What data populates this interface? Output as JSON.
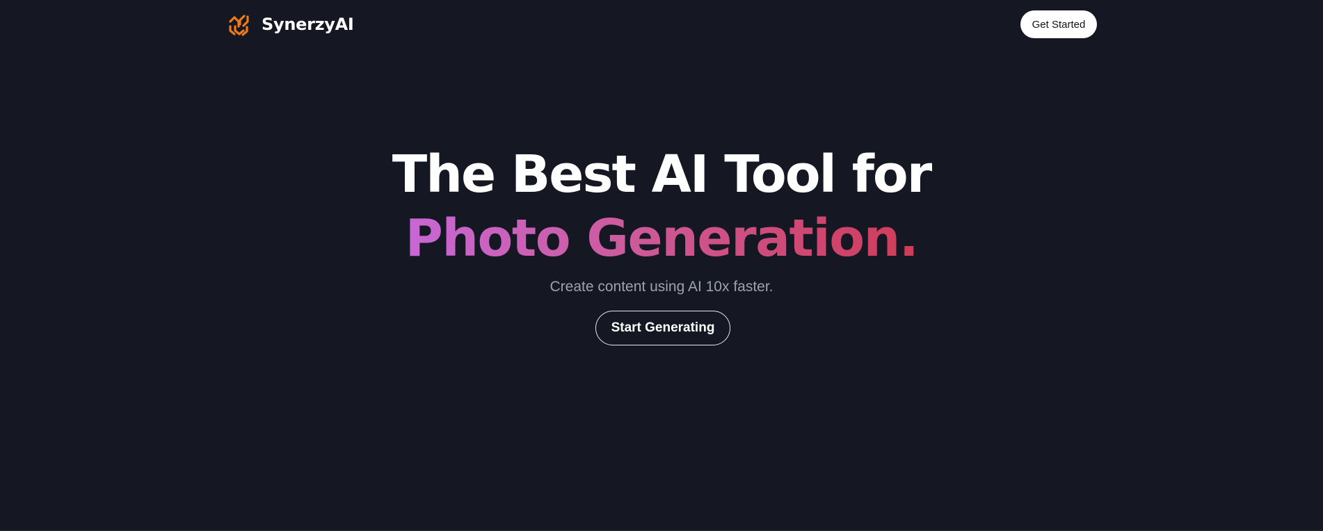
{
  "header": {
    "brand_name": "SynerzyAI",
    "logo_icon": "synerzy-logo-icon",
    "cta_label": "Get Started"
  },
  "hero": {
    "headline_line1": "The Best AI Tool for",
    "headline_line2": "Photo Generation.",
    "subtitle": "Create content using AI 10x faster.",
    "cta_label": "Start Generating"
  },
  "colors": {
    "background": "#151822",
    "logo_orange": "#f07a1a",
    "gradient_start": "#c867d6",
    "gradient_mid": "#cd5a9a",
    "gradient_end": "#cf3c58",
    "subtitle_gray": "#9ca3af"
  }
}
